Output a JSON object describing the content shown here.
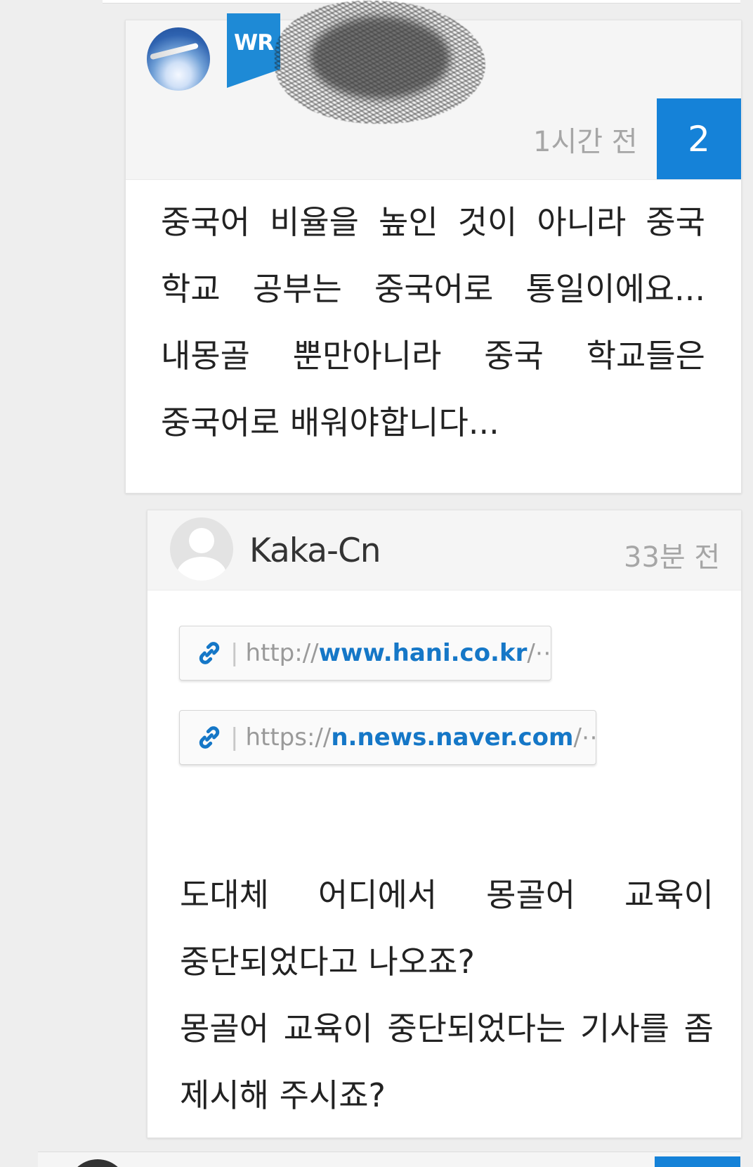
{
  "comments": [
    {
      "author_badge": "WR",
      "time": "1시간 전",
      "reply_count": "2",
      "text": "중국어 비율을 높인 것이 아니라 중국 학교 공부는 중국어로 통일이에요... 내몽골 뿐만아니라 중국 학교들은 중국어로 배워야합니다..."
    },
    {
      "username": "Kaka-Cn",
      "time": "33분 전",
      "links": [
        {
          "scheme": "http://",
          "domain": "www.hani.co.kr",
          "rest": "/⋯"
        },
        {
          "scheme": "https://",
          "domain": "n.news.naver.com",
          "rest": "/⋯"
        }
      ],
      "text_lines": [
        "도대체 어디에서 몽골어 교육이 중단되었다고 나오죠?",
        "몽골어 교육이 중단되었다는 기사를 좀 제시해 주시죠?"
      ]
    }
  ],
  "icons": {
    "link": "link-icon",
    "avatar_default": "default-avatar-icon"
  },
  "colors": {
    "accent": "#1582d8",
    "link_domain": "#1577c7",
    "meta_text": "#a6a6a6"
  }
}
